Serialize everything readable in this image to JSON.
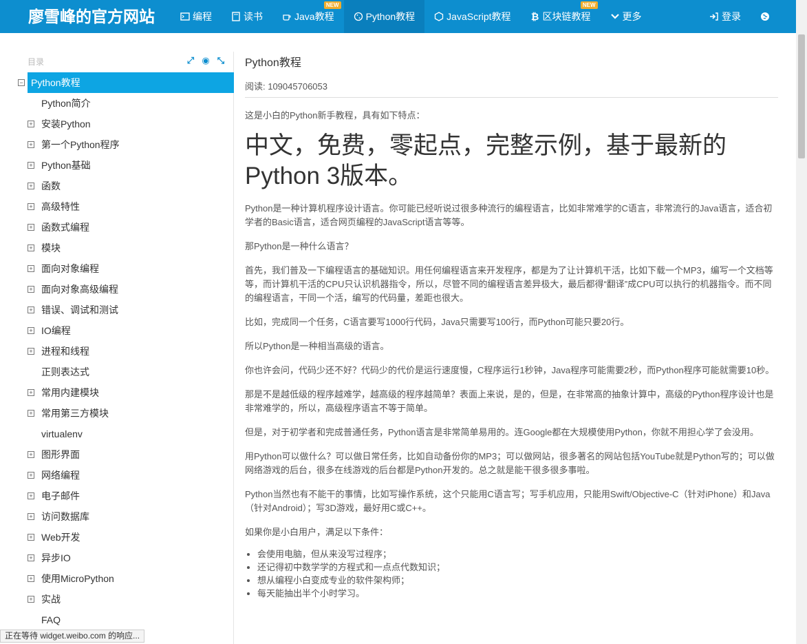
{
  "brand": "廖雪峰的官方网站",
  "nav": [
    {
      "label": "编程",
      "icon": "terminal-icon",
      "new": ""
    },
    {
      "label": "读书",
      "icon": "book-icon",
      "new": ""
    },
    {
      "label": "Java教程",
      "icon": "coffee-icon",
      "new": "NEW"
    },
    {
      "label": "Python教程",
      "icon": "python-icon",
      "new": ""
    },
    {
      "label": "JavaScript教程",
      "icon": "javascript-icon",
      "new": ""
    },
    {
      "label": "区块链教程",
      "icon": "bitcoin-icon",
      "new": "NEW"
    },
    {
      "label": "更多",
      "icon": "chevron-down-icon",
      "new": ""
    }
  ],
  "nav_right": {
    "login": "登录",
    "globe_icon": "globe-icon"
  },
  "toc": {
    "heading": "目录",
    "root": "Python教程",
    "items": [
      {
        "label": "Python简介",
        "expandable": false
      },
      {
        "label": "安装Python",
        "expandable": true
      },
      {
        "label": "第一个Python程序",
        "expandable": true
      },
      {
        "label": "Python基础",
        "expandable": true
      },
      {
        "label": "函数",
        "expandable": true
      },
      {
        "label": "高级特性",
        "expandable": true
      },
      {
        "label": "函数式编程",
        "expandable": true
      },
      {
        "label": "模块",
        "expandable": true
      },
      {
        "label": "面向对象编程",
        "expandable": true
      },
      {
        "label": "面向对象高级编程",
        "expandable": true
      },
      {
        "label": "错误、调试和测试",
        "expandable": true
      },
      {
        "label": "IO编程",
        "expandable": true
      },
      {
        "label": "进程和线程",
        "expandable": true
      },
      {
        "label": "正则表达式",
        "expandable": false
      },
      {
        "label": "常用内建模块",
        "expandable": true
      },
      {
        "label": "常用第三方模块",
        "expandable": true
      },
      {
        "label": "virtualenv",
        "expandable": false
      },
      {
        "label": "图形界面",
        "expandable": true
      },
      {
        "label": "网络编程",
        "expandable": true
      },
      {
        "label": "电子邮件",
        "expandable": true
      },
      {
        "label": "访问数据库",
        "expandable": true
      },
      {
        "label": "Web开发",
        "expandable": true
      },
      {
        "label": "异步IO",
        "expandable": true
      },
      {
        "label": "使用MicroPython",
        "expandable": true
      },
      {
        "label": "实战",
        "expandable": true
      },
      {
        "label": "FAQ",
        "expandable": false
      }
    ]
  },
  "article": {
    "title": "Python教程",
    "reads": "阅读: 109045706053",
    "intro": "这是小白的Python新手教程，具有如下特点：",
    "headline": "中文，免费，零起点，完整示例，基于最新的Python 3版本。",
    "paragraphs": [
      "Python是一种计算机程序设计语言。你可能已经听说过很多种流行的编程语言，比如非常难学的C语言，非常流行的Java语言，适合初学者的Basic语言，适合网页编程的JavaScript语言等等。",
      "那Python是一种什么语言？",
      "首先，我们普及一下编程语言的基础知识。用任何编程语言来开发程序，都是为了让计算机干活，比如下载一个MP3，编写一个文档等等，而计算机干活的CPU只认识机器指令，所以，尽管不同的编程语言差异极大，最后都得“翻译”成CPU可以执行的机器指令。而不同的编程语言，干同一个活，编写的代码量，差距也很大。",
      "比如，完成同一个任务，C语言要写1000行代码，Java只需要写100行，而Python可能只要20行。",
      "所以Python是一种相当高级的语言。",
      "你也许会问，代码少还不好？代码少的代价是运行速度慢，C程序运行1秒钟，Java程序可能需要2秒，而Python程序可能就需要10秒。",
      "那是不是越低级的程序越难学，越高级的程序越简单？表面上来说，是的，但是，在非常高的抽象计算中，高级的Python程序设计也是非常难学的，所以，高级程序语言不等于简单。",
      "但是，对于初学者和完成普通任务，Python语言是非常简单易用的。连Google都在大规模使用Python，你就不用担心学了会没用。",
      "用Python可以做什么？可以做日常任务，比如自动备份你的MP3；可以做网站，很多著名的网站包括YouTube就是Python写的；可以做网络游戏的后台，很多在线游戏的后台都是Python开发的。总之就是能干很多很多事啦。",
      "Python当然也有不能干的事情，比如写操作系统，这个只能用C语言写；写手机应用，只能用Swift/Objective-C（针对iPhone）和Java（针对Android）；写3D游戏，最好用C或C++。",
      "如果你是小白用户，满足以下条件："
    ],
    "conditions": [
      "会使用电脑，但从来没写过程序；",
      "还记得初中数学学的方程式和一点点代数知识；",
      "想从编程小白变成专业的软件架构师；",
      "每天能抽出半个小时学习。"
    ]
  },
  "status": "正在等待 widget.weibo.com 的响应..."
}
